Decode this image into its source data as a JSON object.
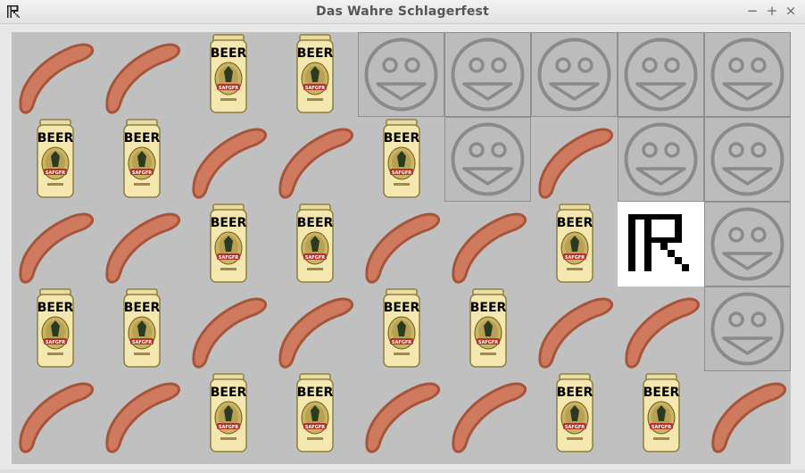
{
  "window": {
    "title": "Das Wahre Schlagerfest",
    "minimize_glyph": "−",
    "maximize_glyph": "+",
    "close_glyph": "×",
    "app_icon": "ar-logo-icon"
  },
  "beer_label": "BEER",
  "beer_sublabel": "SAFGFR",
  "colors": {
    "board": "#c0c0c0",
    "sausage": "#cf7a5e",
    "sausage_outline": "#a6553b",
    "can": "#f5e7b0",
    "smiley_tile": "#bcbcbc",
    "smiley_stroke": "#8a8a8a"
  },
  "board": {
    "rows": 5,
    "cols": 9,
    "cells": [
      [
        "sausage",
        "sausage",
        "beer",
        "beer",
        "smiley",
        "smiley",
        "smiley",
        "smiley",
        "smiley"
      ],
      [
        "beer",
        "beer",
        "sausage",
        "sausage",
        "beer",
        "smiley",
        "sausage",
        "smiley",
        "smiley"
      ],
      [
        "sausage",
        "sausage",
        "beer",
        "beer",
        "sausage",
        "sausage",
        "beer",
        "logo",
        "smiley"
      ],
      [
        "beer",
        "beer",
        "sausage",
        "sausage",
        "beer",
        "beer",
        "sausage",
        "sausage",
        "smiley"
      ],
      [
        "sausage",
        "sausage",
        "beer",
        "beer",
        "sausage",
        "sausage",
        "beer",
        "beer",
        "sausage"
      ]
    ]
  }
}
